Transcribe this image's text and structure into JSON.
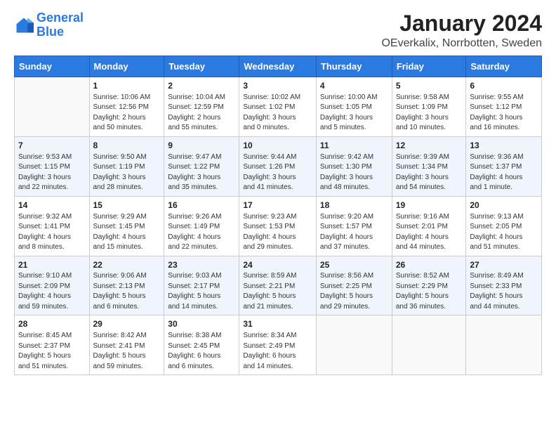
{
  "header": {
    "logo_general": "General",
    "logo_blue": "Blue",
    "month_title": "January 2024",
    "location": "OEverkalix, Norrbotten, Sweden"
  },
  "days_of_week": [
    "Sunday",
    "Monday",
    "Tuesday",
    "Wednesday",
    "Thursday",
    "Friday",
    "Saturday"
  ],
  "weeks": [
    [
      {
        "day": "",
        "info": ""
      },
      {
        "day": "1",
        "info": "Sunrise: 10:06 AM\nSunset: 12:56 PM\nDaylight: 2 hours\nand 50 minutes."
      },
      {
        "day": "2",
        "info": "Sunrise: 10:04 AM\nSunset: 12:59 PM\nDaylight: 2 hours\nand 55 minutes."
      },
      {
        "day": "3",
        "info": "Sunrise: 10:02 AM\nSunset: 1:02 PM\nDaylight: 3 hours\nand 0 minutes."
      },
      {
        "day": "4",
        "info": "Sunrise: 10:00 AM\nSunset: 1:05 PM\nDaylight: 3 hours\nand 5 minutes."
      },
      {
        "day": "5",
        "info": "Sunrise: 9:58 AM\nSunset: 1:09 PM\nDaylight: 3 hours\nand 10 minutes."
      },
      {
        "day": "6",
        "info": "Sunrise: 9:55 AM\nSunset: 1:12 PM\nDaylight: 3 hours\nand 16 minutes."
      }
    ],
    [
      {
        "day": "7",
        "info": "Sunrise: 9:53 AM\nSunset: 1:15 PM\nDaylight: 3 hours\nand 22 minutes."
      },
      {
        "day": "8",
        "info": "Sunrise: 9:50 AM\nSunset: 1:19 PM\nDaylight: 3 hours\nand 28 minutes."
      },
      {
        "day": "9",
        "info": "Sunrise: 9:47 AM\nSunset: 1:22 PM\nDaylight: 3 hours\nand 35 minutes."
      },
      {
        "day": "10",
        "info": "Sunrise: 9:44 AM\nSunset: 1:26 PM\nDaylight: 3 hours\nand 41 minutes."
      },
      {
        "day": "11",
        "info": "Sunrise: 9:42 AM\nSunset: 1:30 PM\nDaylight: 3 hours\nand 48 minutes."
      },
      {
        "day": "12",
        "info": "Sunrise: 9:39 AM\nSunset: 1:34 PM\nDaylight: 3 hours\nand 54 minutes."
      },
      {
        "day": "13",
        "info": "Sunrise: 9:36 AM\nSunset: 1:37 PM\nDaylight: 4 hours\nand 1 minute."
      }
    ],
    [
      {
        "day": "14",
        "info": "Sunrise: 9:32 AM\nSunset: 1:41 PM\nDaylight: 4 hours\nand 8 minutes."
      },
      {
        "day": "15",
        "info": "Sunrise: 9:29 AM\nSunset: 1:45 PM\nDaylight: 4 hours\nand 15 minutes."
      },
      {
        "day": "16",
        "info": "Sunrise: 9:26 AM\nSunset: 1:49 PM\nDaylight: 4 hours\nand 22 minutes."
      },
      {
        "day": "17",
        "info": "Sunrise: 9:23 AM\nSunset: 1:53 PM\nDaylight: 4 hours\nand 29 minutes."
      },
      {
        "day": "18",
        "info": "Sunrise: 9:20 AM\nSunset: 1:57 PM\nDaylight: 4 hours\nand 37 minutes."
      },
      {
        "day": "19",
        "info": "Sunrise: 9:16 AM\nSunset: 2:01 PM\nDaylight: 4 hours\nand 44 minutes."
      },
      {
        "day": "20",
        "info": "Sunrise: 9:13 AM\nSunset: 2:05 PM\nDaylight: 4 hours\nand 51 minutes."
      }
    ],
    [
      {
        "day": "21",
        "info": "Sunrise: 9:10 AM\nSunset: 2:09 PM\nDaylight: 4 hours\nand 59 minutes."
      },
      {
        "day": "22",
        "info": "Sunrise: 9:06 AM\nSunset: 2:13 PM\nDaylight: 5 hours\nand 6 minutes."
      },
      {
        "day": "23",
        "info": "Sunrise: 9:03 AM\nSunset: 2:17 PM\nDaylight: 5 hours\nand 14 minutes."
      },
      {
        "day": "24",
        "info": "Sunrise: 8:59 AM\nSunset: 2:21 PM\nDaylight: 5 hours\nand 21 minutes."
      },
      {
        "day": "25",
        "info": "Sunrise: 8:56 AM\nSunset: 2:25 PM\nDaylight: 5 hours\nand 29 minutes."
      },
      {
        "day": "26",
        "info": "Sunrise: 8:52 AM\nSunset: 2:29 PM\nDaylight: 5 hours\nand 36 minutes."
      },
      {
        "day": "27",
        "info": "Sunrise: 8:49 AM\nSunset: 2:33 PM\nDaylight: 5 hours\nand 44 minutes."
      }
    ],
    [
      {
        "day": "28",
        "info": "Sunrise: 8:45 AM\nSunset: 2:37 PM\nDaylight: 5 hours\nand 51 minutes."
      },
      {
        "day": "29",
        "info": "Sunrise: 8:42 AM\nSunset: 2:41 PM\nDaylight: 5 hours\nand 59 minutes."
      },
      {
        "day": "30",
        "info": "Sunrise: 8:38 AM\nSunset: 2:45 PM\nDaylight: 6 hours\nand 6 minutes."
      },
      {
        "day": "31",
        "info": "Sunrise: 8:34 AM\nSunset: 2:49 PM\nDaylight: 6 hours\nand 14 minutes."
      },
      {
        "day": "",
        "info": ""
      },
      {
        "day": "",
        "info": ""
      },
      {
        "day": "",
        "info": ""
      }
    ]
  ]
}
